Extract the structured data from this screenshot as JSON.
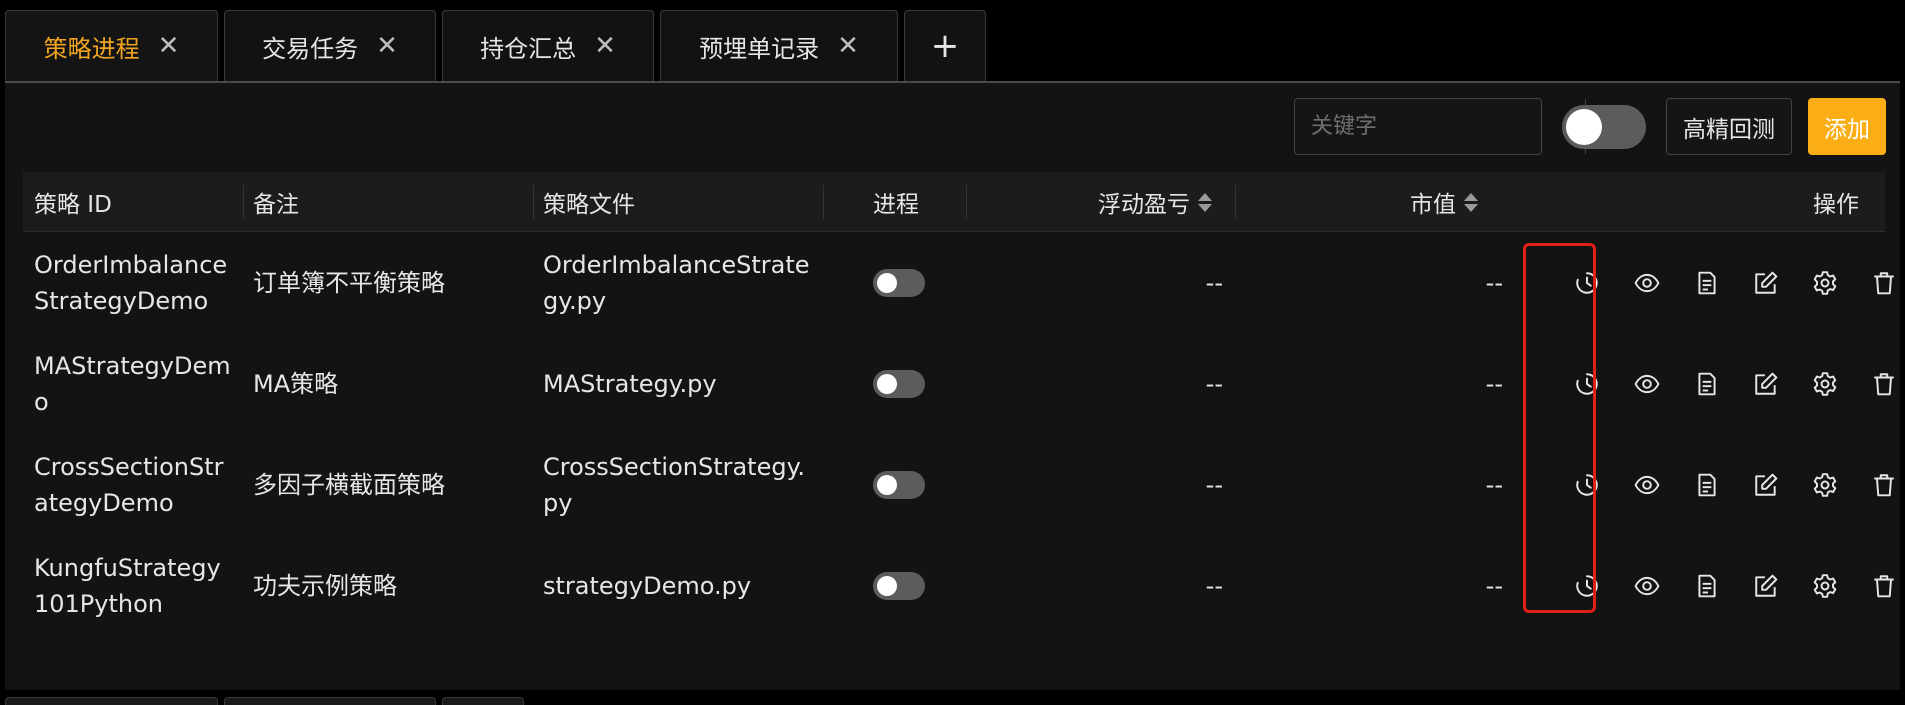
{
  "tabs": [
    {
      "label": "策略进程",
      "active": true
    },
    {
      "label": "交易任务",
      "active": false
    },
    {
      "label": "持仓汇总",
      "active": false
    },
    {
      "label": "预埋单记录",
      "active": false
    }
  ],
  "tab_add_label": "+",
  "toolbar": {
    "search_placeholder": "关键字",
    "backtest_label": "高精回测",
    "add_label": "添加",
    "toggle_on": false
  },
  "table": {
    "columns": {
      "id": "策略 ID",
      "remark": "备注",
      "file": "策略文件",
      "process": "进程",
      "pnl": "浮动盈亏",
      "market_value": "市值",
      "actions": "操作"
    },
    "rows": [
      {
        "id": "OrderImbalanceStrategyDemo",
        "remark": "订单簿不平衡策略",
        "file": "OrderImbalanceStrategy.py",
        "running": false,
        "pnl": "--",
        "market_value": "--"
      },
      {
        "id": "MAStrategyDemo",
        "remark": "MA策略",
        "file": "MAStrategy.py",
        "running": false,
        "pnl": "--",
        "market_value": "--"
      },
      {
        "id": "CrossSectionStrategyDemo",
        "remark": "多因子横截面策略",
        "file": "CrossSectionStrategy.py",
        "running": false,
        "pnl": "--",
        "market_value": "--"
      },
      {
        "id": "KungfuStrategy101Python",
        "remark": "功夫示例策略",
        "file": "strategyDemo.py",
        "running": false,
        "pnl": "--",
        "market_value": "--"
      }
    ],
    "action_icons": [
      "history-icon",
      "eye-icon",
      "document-icon",
      "edit-icon",
      "gear-icon",
      "trash-icon"
    ]
  },
  "colors": {
    "accent": "#faad14",
    "active_tab_text": "#f0a520",
    "highlight_border": "#e0201b",
    "background": "#131313"
  }
}
